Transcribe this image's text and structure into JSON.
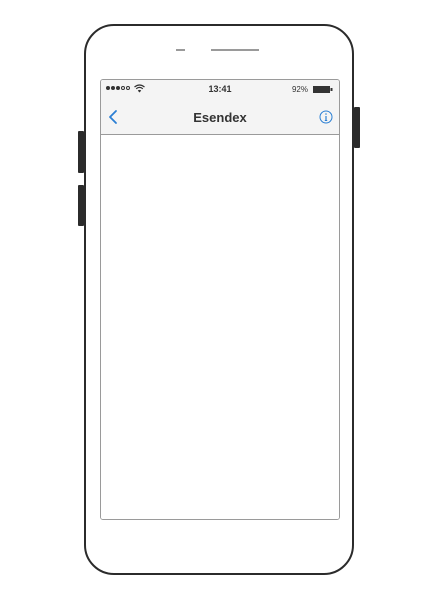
{
  "status_bar": {
    "signal_icon": "signal-dots-icon",
    "wifi_icon": "wifi-icon",
    "time": "13:41",
    "battery_percent": "92%",
    "battery_icon": "battery-icon"
  },
  "nav_bar": {
    "back_icon": "chevron-left-icon",
    "title": "Esendex",
    "info_icon": "info-icon",
    "accent_color": "#2a7fd4"
  },
  "device": {
    "frame_color": "#2b2b2b",
    "screen_bar_color": "#f4f4f4"
  }
}
